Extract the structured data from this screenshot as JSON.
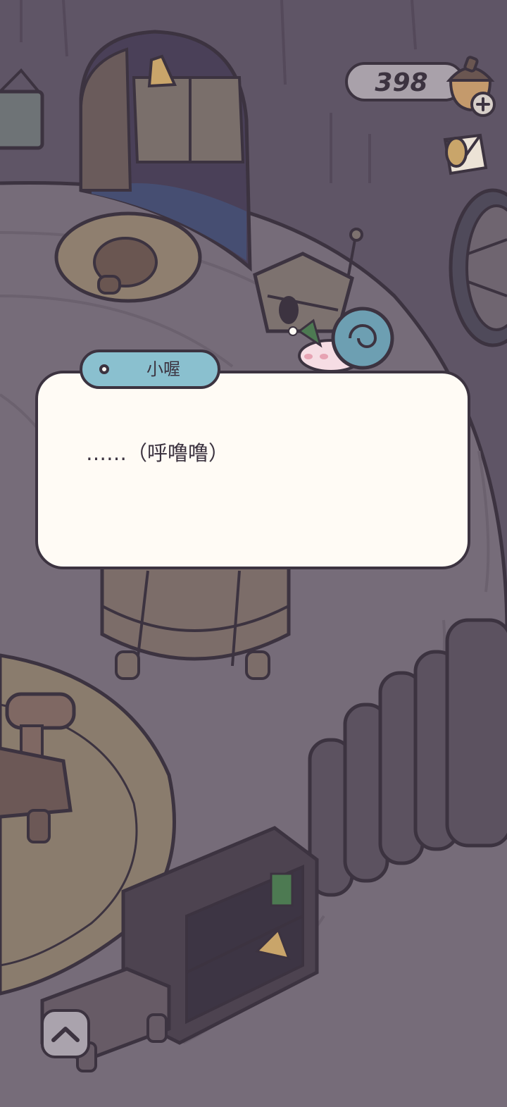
{
  "hud": {
    "currency_value": "398",
    "currency_icon": "acorn-icon",
    "add_icon": "plus-icon",
    "mail_icon": "mail-envelope-icon"
  },
  "dialog": {
    "speaker_name": "小喔",
    "text": "……（呼噜噜）"
  },
  "controls": {
    "expand_icon": "chevron-up-icon"
  },
  "colors": {
    "background": "#5f5566",
    "outline": "#3c3340",
    "dialog_fill": "#fffbf5",
    "name_tag": "#8ac0cf",
    "snail_shell": "#6d9fb2"
  }
}
